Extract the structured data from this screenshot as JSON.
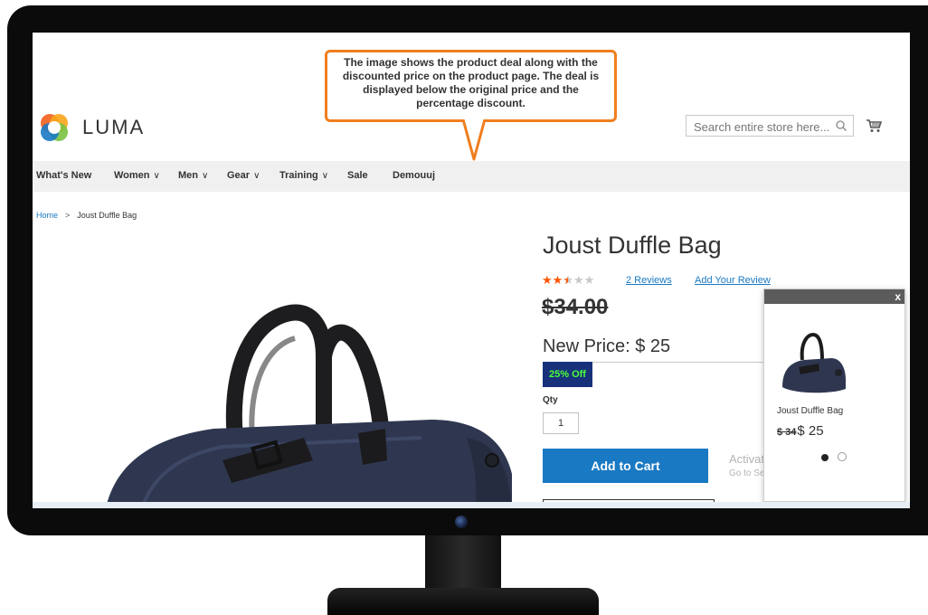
{
  "callout": {
    "text": "The image shows the product deal along with the discounted price on the product page. The deal is displayed below the original price and the percentage discount."
  },
  "header": {
    "logo_text": "LUMA",
    "search_placeholder": "Search entire store here..."
  },
  "nav": {
    "items": [
      {
        "label": "What's New",
        "has_dropdown": false
      },
      {
        "label": "Women",
        "has_dropdown": true
      },
      {
        "label": "Men",
        "has_dropdown": true
      },
      {
        "label": "Gear",
        "has_dropdown": true
      },
      {
        "label": "Training",
        "has_dropdown": true
      },
      {
        "label": "Sale",
        "has_dropdown": false
      },
      {
        "label": "Demouuj",
        "has_dropdown": false
      }
    ]
  },
  "breadcrumb": {
    "home": "Home",
    "current": "Joust Duffle Bag"
  },
  "product": {
    "title": "Joust Duffle Bag",
    "rating_stars": 2.5,
    "rating_max": 5,
    "reviews_link": "2  Reviews",
    "add_review_link": "Add Your Review",
    "old_price": "$34.00",
    "new_price": "New Price: $ 25",
    "discount_badge": "25% Off",
    "qty_label": "Qty",
    "qty_value": "1",
    "add_to_cart": "Add to Cart"
  },
  "popup": {
    "close": "x",
    "product_name": "Joust Duffle Bag",
    "old_price": "$ 34",
    "new_price": "$ 25"
  },
  "watermark": {
    "title": "Activate Windows",
    "subtitle": "Go to Settings to activate Windows."
  },
  "colors": {
    "accent_blue": "#1979c3",
    "callout_orange": "#f07e1e",
    "star_orange": "#ff5501",
    "discount_bg": "#17327a",
    "discount_text": "#4cff3a"
  }
}
